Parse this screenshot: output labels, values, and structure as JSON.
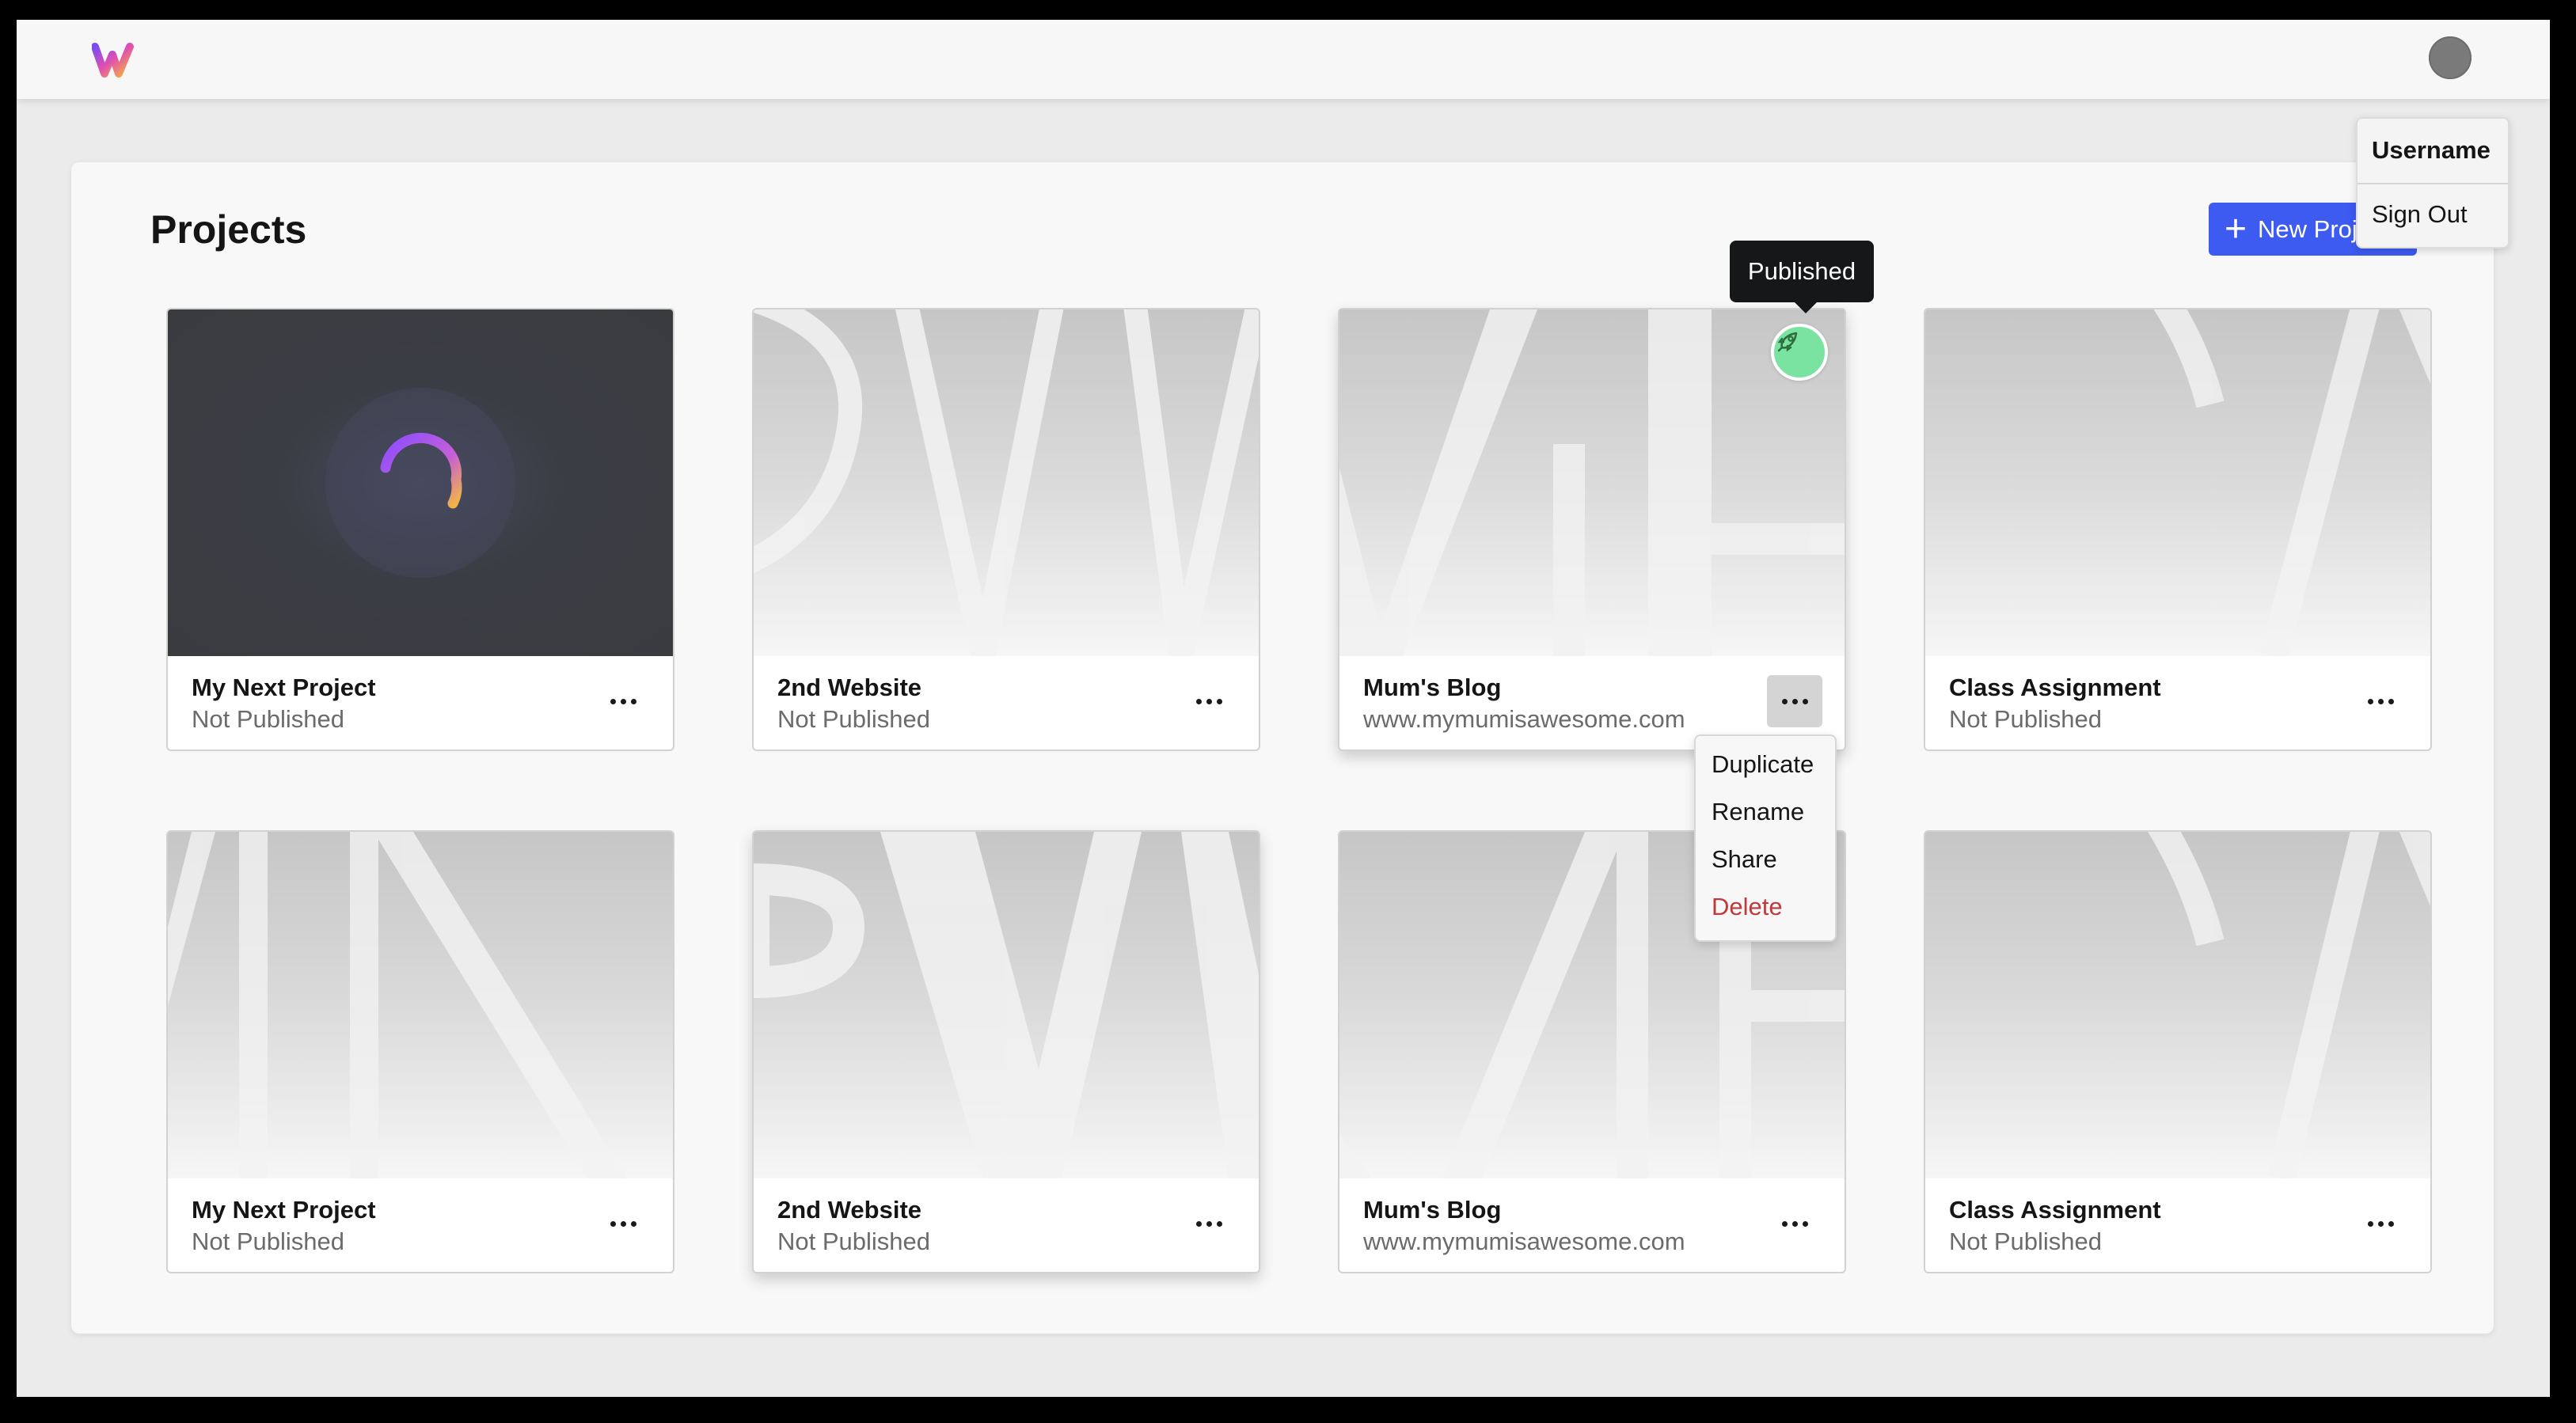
{
  "header": {
    "logo_icon": "w-logo-icon",
    "avatar_icon": "user-avatar-icon"
  },
  "user_menu": {
    "username": "Username",
    "sign_out": "Sign Out"
  },
  "projects": {
    "title": "Projects",
    "new_project_label": "New Project",
    "new_project_icon": "plus-icon",
    "accent_color": "#3d5af1",
    "cards": [
      {
        "name": "My Next Project",
        "status": "Not Published"
      },
      {
        "name": "2nd Website",
        "status": "Not Published"
      },
      {
        "name": "Mum's Blog",
        "status": "www.mymumisawesome.com"
      },
      {
        "name": "Class Assignment",
        "status": "Not Published"
      },
      {
        "name": "My Next Project",
        "status": "Not Published"
      },
      {
        "name": "2nd Website",
        "status": "Not Published"
      },
      {
        "name": "Mum's Blog",
        "status": "www.mymumisawesome.com"
      },
      {
        "name": "Class Assignment",
        "status": "Not Published"
      }
    ]
  },
  "published_tooltip": "Published",
  "published_badge_icon": "rocket-icon",
  "published_color": "#7be3a1",
  "context_menu": {
    "duplicate": "Duplicate",
    "rename": "Rename",
    "share": "Share",
    "delete": "Delete",
    "delete_color": "#c0393b"
  }
}
